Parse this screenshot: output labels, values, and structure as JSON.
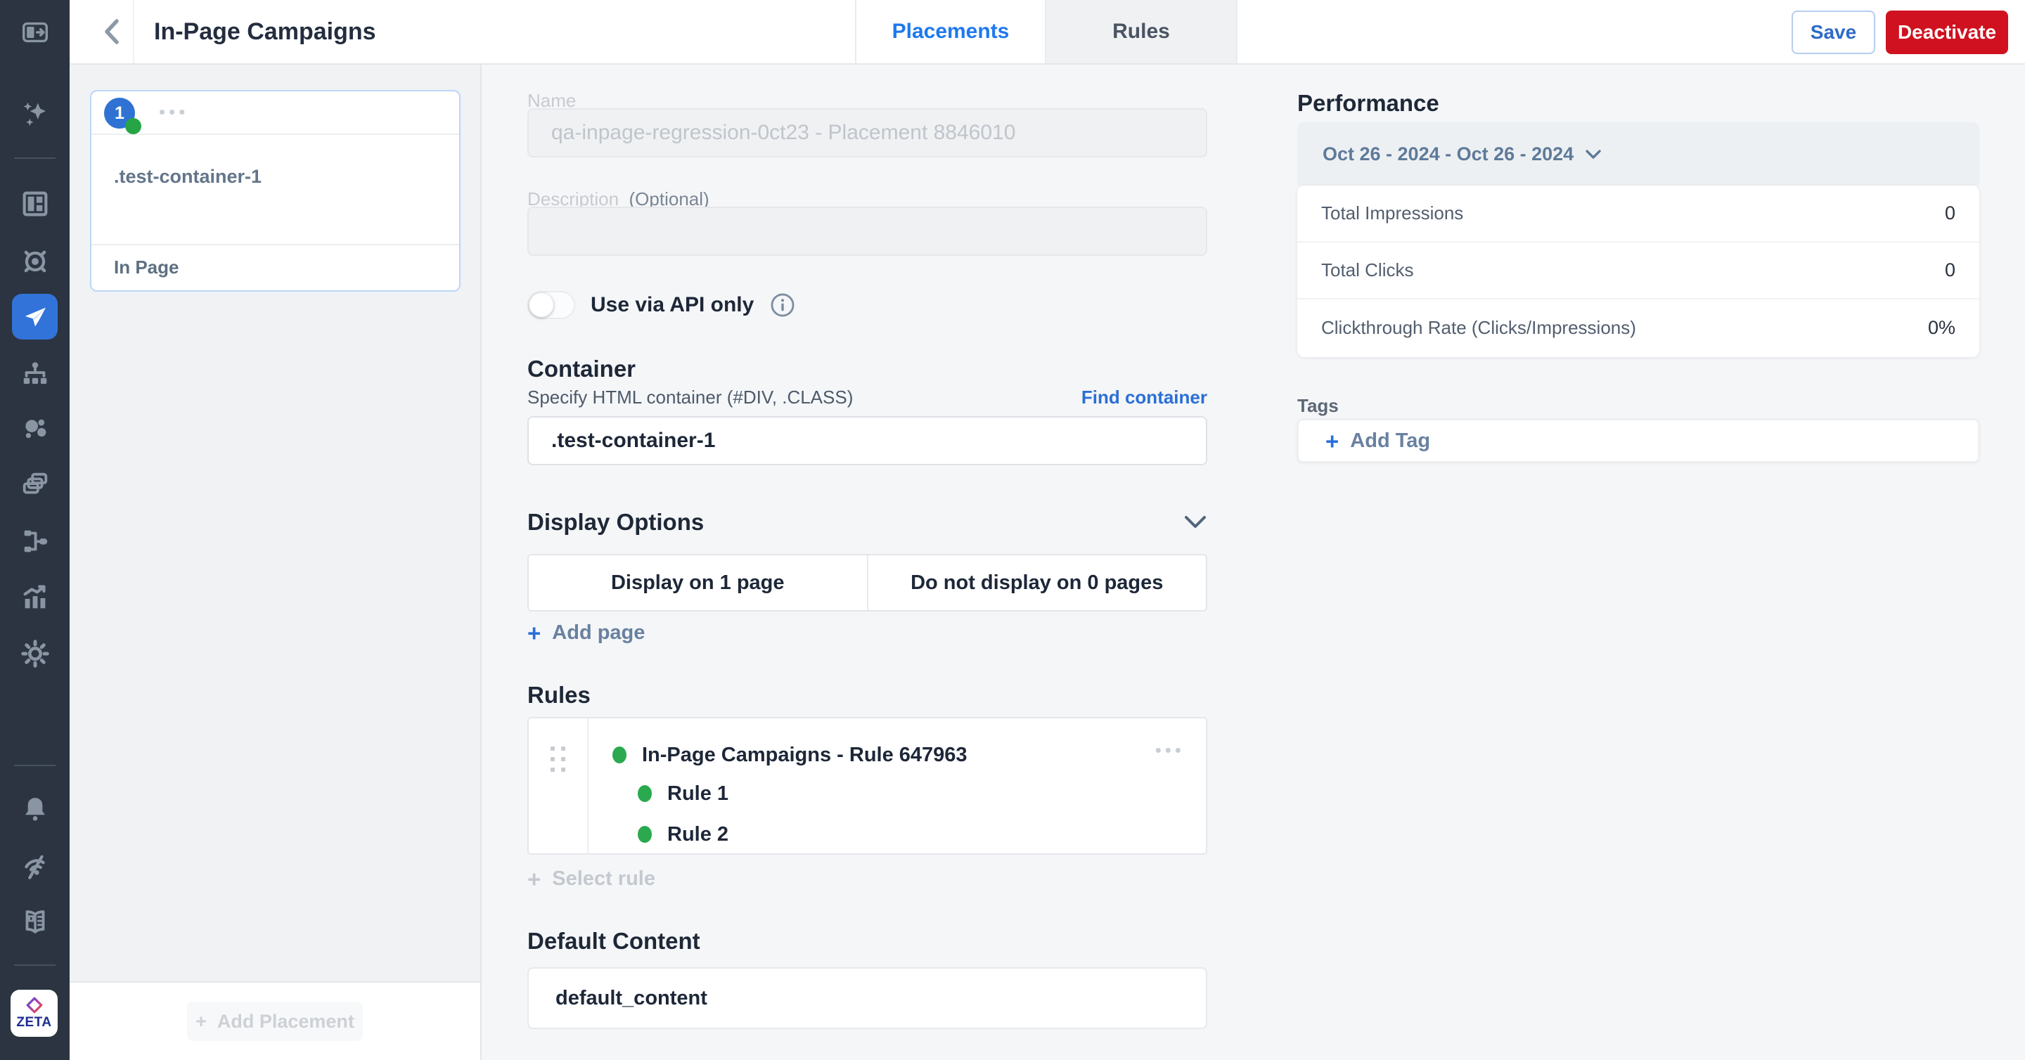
{
  "header": {
    "title": "In-Page Campaigns",
    "tabs": [
      {
        "label": "Placements"
      },
      {
        "label": "Rules"
      }
    ],
    "save_label": "Save",
    "deactivate_label": "Deactivate"
  },
  "sidebar": {
    "logo_text": "ZETA"
  },
  "placements_panel": {
    "card": {
      "badge": "1",
      "menu": "•••",
      "name": ".test-container-1",
      "type": "In Page"
    },
    "add_placement_label": "Add Placement"
  },
  "form": {
    "name_label": "Name",
    "name_value": "qa-inpage-regression-0ct23 - Placement 8846010",
    "description_label": "Description",
    "description_optional": "(Optional)",
    "description_value": "",
    "api_toggle_label": "Use via API only",
    "container": {
      "heading": "Container",
      "spec_label": "Specify HTML container (#DIV, .CLASS)",
      "find_link": "Find container",
      "value": ".test-container-1"
    },
    "display_options": {
      "heading": "Display Options",
      "display_tab": "Display on 1 page",
      "hide_tab": "Do not display on 0 pages",
      "add_page_label": "Add page"
    },
    "rules": {
      "heading": "Rules",
      "main_rule": "In-Page Campaigns - Rule 647963",
      "menu": "•••",
      "sub_rules": [
        {
          "label": "Rule 1"
        },
        {
          "label": "Rule 2"
        }
      ],
      "select_rule_label": "Select rule"
    },
    "default_content": {
      "heading": "Default Content",
      "value": "default_content"
    }
  },
  "performance": {
    "heading": "Performance",
    "date_range": "Oct 26 - 2024 - Oct 26 - 2024",
    "rows": [
      {
        "label": "Total Impressions",
        "value": "0"
      },
      {
        "label": "Total Clicks",
        "value": "0"
      },
      {
        "label": "Clickthrough Rate (Clicks/Impressions)",
        "value": "0%"
      }
    ]
  },
  "tags": {
    "label": "Tags",
    "add_tag_label": "Add Tag"
  },
  "colors": {
    "accent_blue": "#1e79ef",
    "link_blue": "#2a6fd6",
    "deactivate_red": "#d0111f",
    "active_nav_blue": "#3273d9",
    "success_green": "#2aa94f",
    "sidebar_bg": "#2b3440"
  }
}
